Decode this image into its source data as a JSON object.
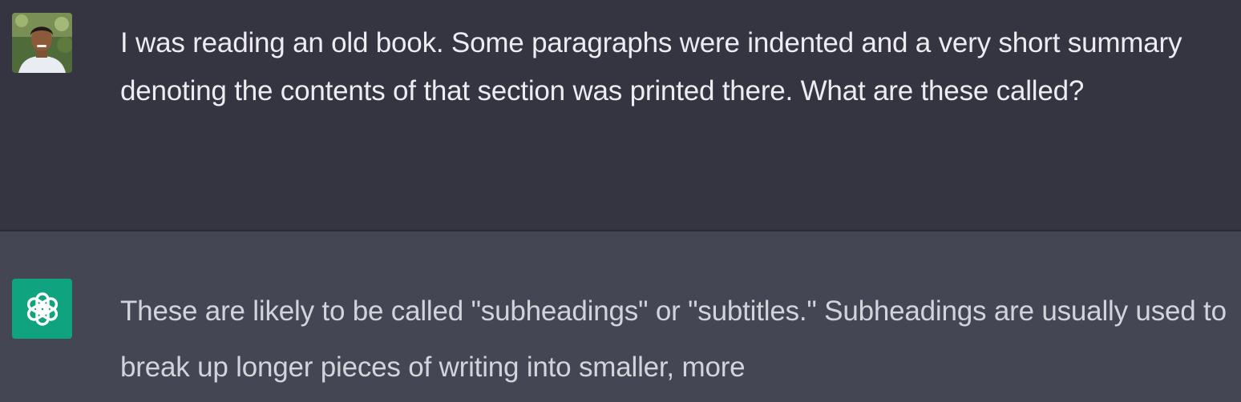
{
  "colors": {
    "user_bg": "#343541",
    "assistant_bg": "#444654",
    "assistant_avatar": "#10a37f",
    "user_text": "#ececf1",
    "assistant_text": "#d1d5db"
  },
  "conversation": {
    "user_message": {
      "avatar_icon": "user-photo-avatar",
      "text": "I was reading an old book. Some paragraphs were indented and a very short summary denoting the contents of that section was printed there. What are these called?"
    },
    "assistant_message": {
      "avatar_icon": "openai-logo-icon",
      "text": "These are likely to be called \"subheadings\" or \"subtitles.\" Subheadings are usually used to break up longer pieces of writing into smaller, more"
    }
  }
}
